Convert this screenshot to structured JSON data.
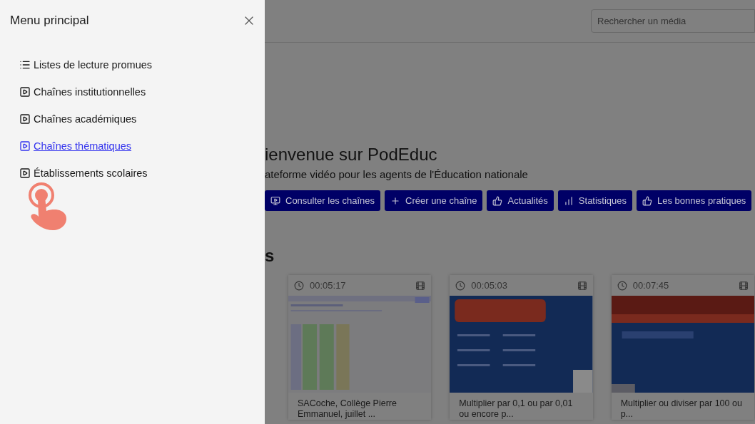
{
  "drawer": {
    "title": "Menu principal",
    "items": [
      {
        "kind": "list",
        "label": "Listes de lecture promues",
        "selected": false
      },
      {
        "kind": "channel",
        "label": "Chaînes institutionnelles",
        "selected": false
      },
      {
        "kind": "channel",
        "label": "Chaînes académiques",
        "selected": false
      },
      {
        "kind": "channel",
        "label": "Chaînes thématiques",
        "selected": true
      },
      {
        "kind": "channel",
        "label": "Établissements scolaires",
        "selected": false
      }
    ]
  },
  "search": {
    "placeholder": "Rechercher un média"
  },
  "hero": {
    "title": "ienvenue sur PodEduc",
    "subtitle": "ateforme vidéo pour les agents de l'Éducation nationale"
  },
  "buttons": [
    {
      "kind": "channels",
      "label": "Consulter les chaînes"
    },
    {
      "kind": "add",
      "label": "Créer une chaîne"
    },
    {
      "kind": "thumb",
      "label": "Actualités"
    },
    {
      "kind": "stats",
      "label": "Statistiques"
    },
    {
      "kind": "thumb",
      "label": "Les bonnes pratiques"
    }
  ],
  "section": {
    "title": "s"
  },
  "videos": [
    {
      "duration": "00:05:17",
      "title": "SACoche, Collège Pierre Emmanuel, juillet ...",
      "kind": "picture"
    },
    {
      "duration": "00:05:03",
      "title": "Multiplier par 0,1 ou par 0,01 ou encore p...",
      "kind": "picture"
    },
    {
      "duration": "00:07:45",
      "title": "Multiplier ou diviser par 100 ou p...",
      "kind": "picture"
    }
  ]
}
